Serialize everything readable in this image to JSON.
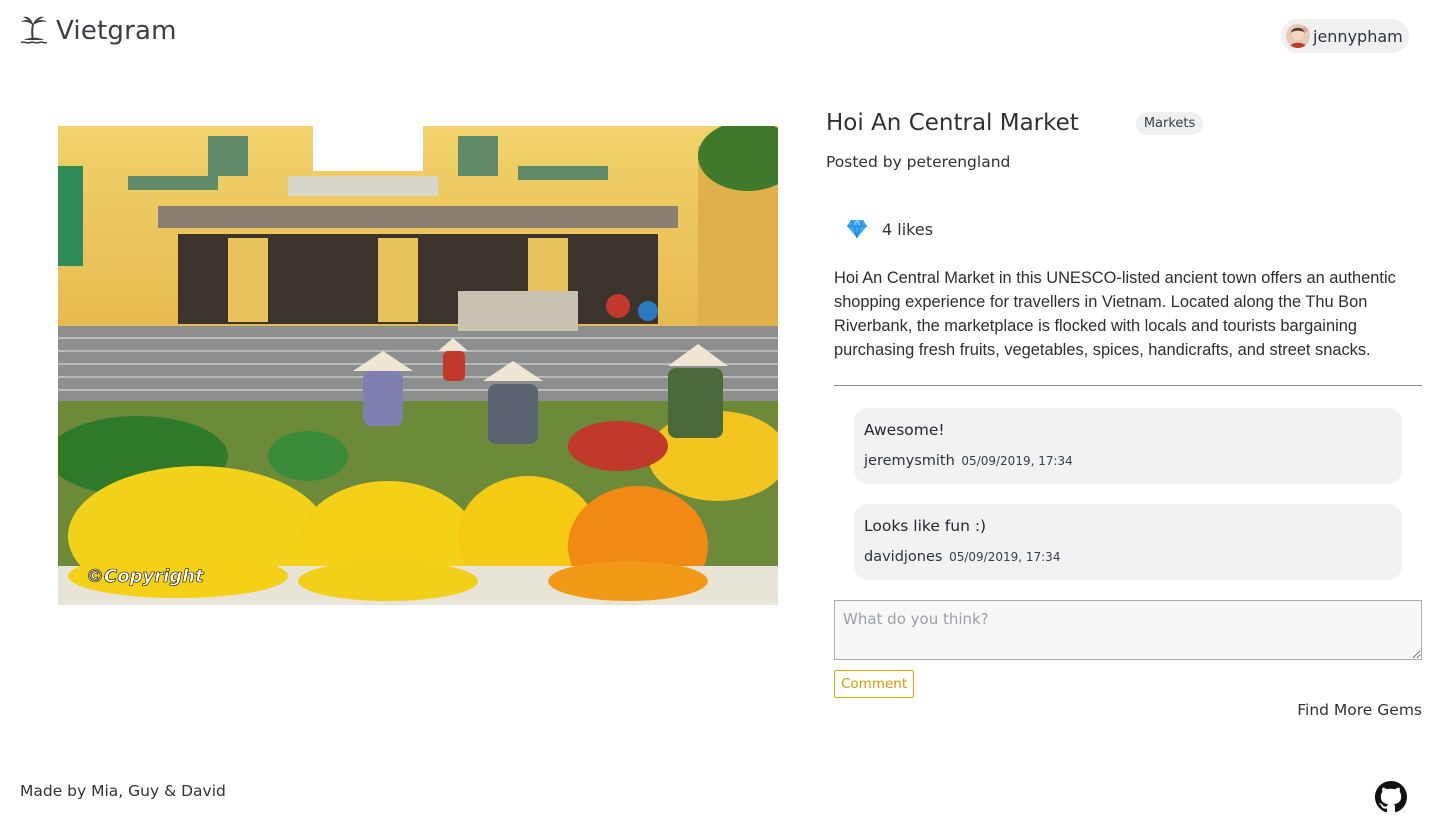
{
  "header": {
    "brand_name": "Vietgram",
    "brand_icon": "palm-island-icon",
    "user": {
      "username": "jennypham",
      "avatar_icon": "user-avatar"
    }
  },
  "post": {
    "image": {
      "watermark": "©Copyright"
    },
    "title": "Hoi An Central Market",
    "category": "Markets",
    "posted_by": "Posted by peterengland",
    "likes": {
      "icon": "gem-icon",
      "text": "4 likes"
    },
    "description": "Hoi An Central Market in this UNESCO-listed ancient town offers an authentic shopping experience for travellers in Vietnam. Located along the Thu Bon Riverbank, the marketplace is flocked with locals and tourists bargaining purchasing fresh fruits, vegetables, spices, handicrafts, and street snacks."
  },
  "comments": [
    {
      "text": "Awesome!",
      "author": "jeremysmith",
      "time": "05/09/2019, 17:34"
    },
    {
      "text": "Looks like fun :)",
      "author": "davidjones",
      "time": "05/09/2019, 17:34"
    }
  ],
  "comment_form": {
    "placeholder": "What do you think?",
    "button_label": "Comment"
  },
  "find_more_label": "Find More Gems",
  "footer": {
    "credit": "Made by Mia, Guy & David",
    "github_icon": "github-icon"
  },
  "colors": {
    "accent": "#e0a800",
    "chip_bg": "#eef0f2",
    "comment_bg": "#f1f2f4",
    "text": "#2f3337"
  }
}
